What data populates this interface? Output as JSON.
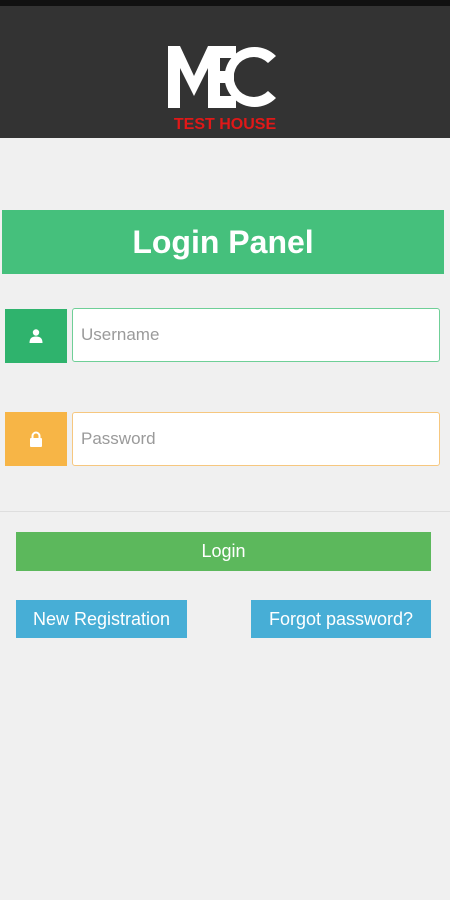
{
  "header": {
    "logo_main": "MEC",
    "logo_sub": "TEST HOUSE"
  },
  "panel": {
    "title": "Login Panel",
    "username_placeholder": "Username",
    "password_placeholder": "Password",
    "user_icon": "user-icon",
    "lock_icon": "lock-icon"
  },
  "actions": {
    "login_label": "Login",
    "register_label": "New Registration",
    "forgot_label": "Forgot password?"
  },
  "colors": {
    "header_bg": "#333333",
    "title_bg": "#45c07c",
    "user_addon": "#2fb36d",
    "lock_addon": "#f7b546",
    "login_btn": "#5cb85c",
    "secondary_btn": "#47aed6",
    "logo_red": "#e01818"
  }
}
